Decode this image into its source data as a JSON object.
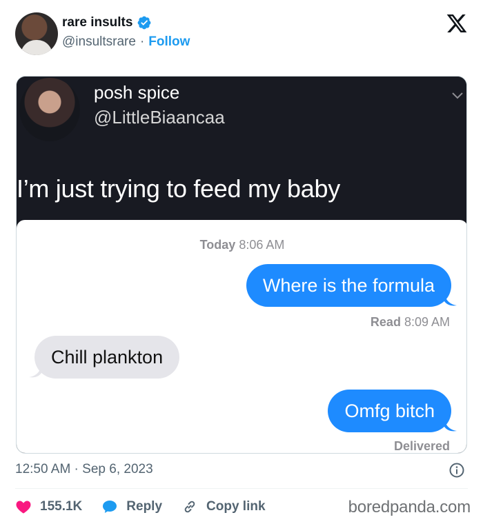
{
  "author": {
    "display_name": "rare insults",
    "handle": "@insultsrare",
    "separator": "·",
    "follow_label": "Follow"
  },
  "embedded": {
    "name": "posh spice",
    "handle": "@LittleBiaancaa",
    "text": "I’m just trying to feed my baby"
  },
  "chat": {
    "timestamp_day": "Today",
    "timestamp_time": "8:06 AM",
    "messages": [
      {
        "direction": "out",
        "text": "Where is the formula"
      },
      {
        "direction": "in",
        "text": "Chill plankton"
      },
      {
        "direction": "out",
        "text": "Omfg bitch"
      }
    ],
    "read_label": "Read",
    "read_time": "8:09 AM",
    "delivered_label": "Delivered"
  },
  "post_time": "12:50 AM · Sep 6, 2023",
  "actions": {
    "likes": "155.1K",
    "reply_label": "Reply",
    "copy_link_label": "Copy link"
  },
  "watermark": "boredpanda.com",
  "colors": {
    "accent": "#1d9bf0",
    "like": "#f91880",
    "imessage_blue": "#1e8bff",
    "imessage_gray": "#e5e5ea"
  }
}
